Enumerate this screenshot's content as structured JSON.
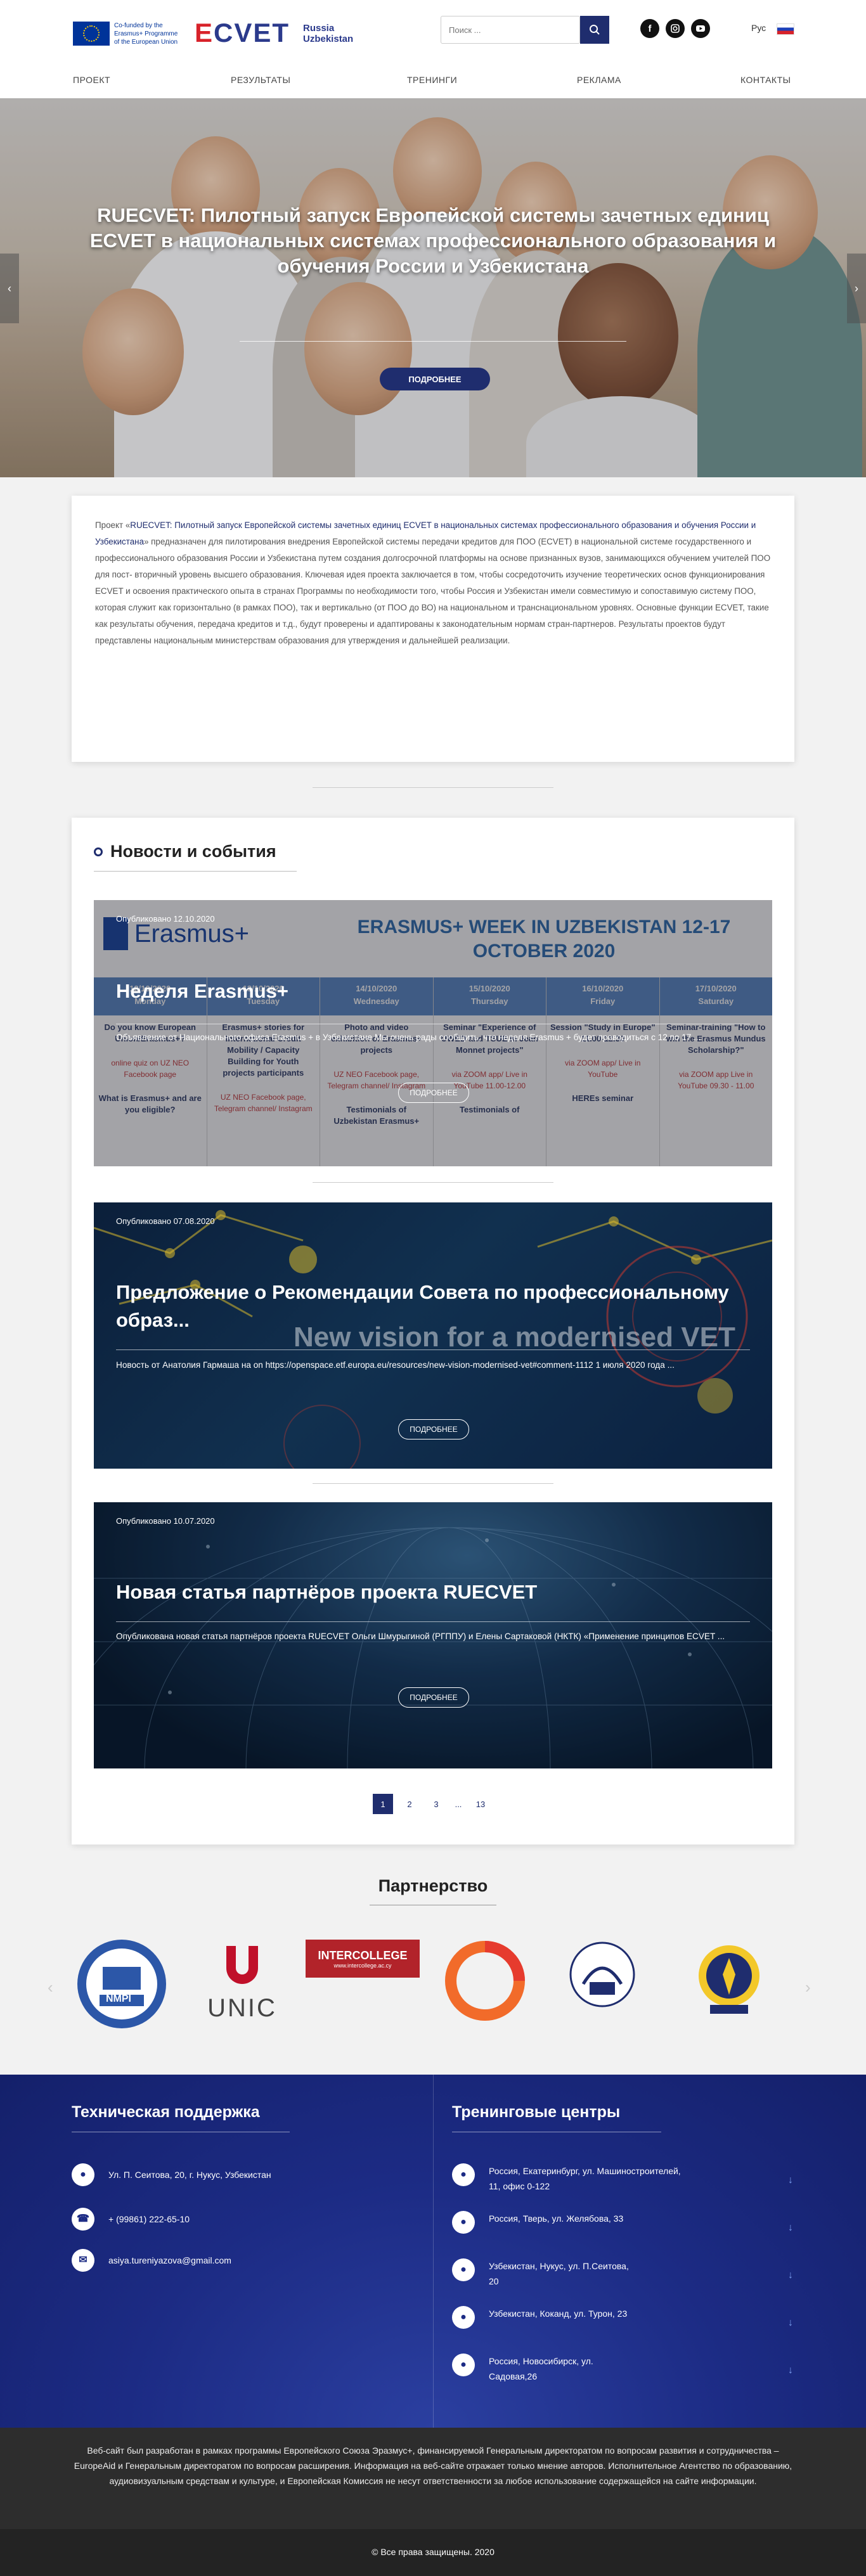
{
  "header": {
    "eu_text": "Co-funded by the Erasmus+ Programme of the European Union",
    "logo_text": "ECVET",
    "logo_sub": "Russia Uzbekistan",
    "search_placeholder": "Поиск ...",
    "lang": "Рус"
  },
  "nav": [
    "ПРОЕКТ",
    "РЕЗУЛЬТАТЫ",
    "ТРЕНИНГИ",
    "РЕКЛАМА",
    "КОНТАКТЫ"
  ],
  "hero": {
    "title": "RUECVET: Пилотный запуск Европейской системы зачетных единиц ECVET в национальных системах профессионального образования и обучения России и Узбекистана",
    "button": "ПОДРОБНЕЕ"
  },
  "about": {
    "prefix": "Проект «",
    "highlight": "RUECVET: Пилотный запуск Европейской системы зачетных единиц ECVET в национальных системах профессионального образования и обучения России и Узбекистана",
    "body": "» предназначен для пилотирования внедрения Европейской системы передачи кредитов для ПОО (ECVET) в национальной системе государственного и профессионального образования России и Узбекистана путем создания долгосрочной платформы на основе признанных вузов, занимающихся обучением учителей ПОО для пост- вторичный уровень высшего образования. Ключевая идея проекта заключается в том, чтобы сосредоточить изучение теоретических основ функционирования ECVET и освоения практического опыта в странах Программы по необходимости того, чтобы Россия и Узбекистан имели совместимую и сопоставимую систему ПОО, которая служит как горизонтально (в рамках ПОО), так и вертикально (от ПОО до ВО) на национальном и транснациональном уровнях. Основные функции ECVET, такие как результаты обучения, передача кредитов и т.д., будут проверены и адаптированы к законодательным нормам стран-партнеров. Результаты проектов будут представлены национальным министерствам образования для утверждения и дальнейшей реализации."
  },
  "news": {
    "title": "Новости и события",
    "button": "ПОДРОБНЕЕ",
    "posts": [
      {
        "date": "Опубликовано 12.10.2020",
        "title": "Неделя Erasmus+",
        "excerpt": "Объявление от Национального офиса Erasmus + в Узбекистане Мы очень рады сообщить, что неделя Erasmus + будет проводиться с 12 по 17 ..."
      },
      {
        "date": "Опубликовано 07.08.2020",
        "title": "Предложение о Рекомендации Совета по профессиональному образ...",
        "excerpt": "Новость от Анатолия Гармаша на on https://openspace.etf.europa.eu/resources/new-vision-modernised-vet#comment-1112 1 июля 2020 года ..."
      },
      {
        "date": "Опубликовано 10.07.2020",
        "title": "Новая статья партнёров проекта RUECVET",
        "excerpt": "Опубликована новая статья партнёров проекта RUECVET Ольги Шмурыгиной (РГППУ) и Елены Сартаковой (НКТК) «Применение принципов ECVET ..."
      }
    ],
    "erasmus_banner": {
      "logo": "Erasmus+",
      "heading": "ERASMUS+ WEEK IN UZBEKISTAN 12-17 OCTOBER 2020",
      "days": [
        {
          "date": "12/10/2020",
          "day": "Monday",
          "text": "Do you know European Union/Erasmus+?",
          "note": "online quiz on UZ NEO Facebook page",
          "extra": "What is Erasmus+ and are you eligible?"
        },
        {
          "date": "13/10/2020",
          "day": "Tuesday",
          "text": "Erasmus+ stories for International Credit Mobility / Capacity Building for Youth projects participants",
          "note": "UZ NEO Facebook page, Telegram channel/ Instagram",
          "extra": ""
        },
        {
          "date": "14/10/2020",
          "day": "Wednesday",
          "text": "Photo and video exhibition of Erasmus+ projects",
          "note": "UZ NEO Facebook page, Telegram channel/ Instagram",
          "extra": "Testimonials of Uzbekistan Erasmus+"
        },
        {
          "date": "15/10/2020",
          "day": "Thursday",
          "text": "Seminar \"Experience of UWED and TSUE in Jean Monnet projects\"",
          "note": "via ZOOM app/ Live in YouTube 11.00-12.00",
          "extra": "Testimonials of"
        },
        {
          "date": "16/10/2020",
          "day": "Friday",
          "text": "Session \"Study in Europe\" 11.00-12.30",
          "note": "via ZOOM app/ Live in YouTube",
          "extra": "HEREs seminar"
        },
        {
          "date": "17/10/2020",
          "day": "Saturday",
          "text": "Seminar-training \"How to win the Erasmus Mundus Scholarship?\"",
          "note": "via ZOOM app Live in YouTube 09.30 - 11.00",
          "extra": ""
        }
      ]
    },
    "vet_banner_text": "New vision for a modernised VET",
    "pages": [
      "1",
      "2",
      "3",
      "...",
      "13"
    ]
  },
  "partners": {
    "title": "Партнерство",
    "logos": [
      "NMPI",
      "UNIC",
      "INTERCOLLEGE",
      "www.intercollege.ac.cy"
    ]
  },
  "footer": {
    "support_title": "Техническая поддержка",
    "support": [
      {
        "icon": "location-icon",
        "text": "Ул. П. Сеитова, 20, г. Нукус, Узбекистан"
      },
      {
        "icon": "phone-icon",
        "text": "+ (99861) 222-65-10"
      },
      {
        "icon": "email-icon",
        "text": "asiya.tureniyazova@gmail.com"
      }
    ],
    "centers_title": "Тренинговые центры",
    "centers": [
      "Россия, Екатеринбург, ул. Машиностроителей, 11, офис 0-122",
      "Россия, Тверь, ул. Желябова, 33",
      "Узбекистан, Нукус, ул. П.Сеитова, 20",
      "Узбекистан, Коканд, ул. Турон, 23",
      "Россия, Новосибирск, ул. Садовая,26"
    ],
    "disclaimer": "Веб-сайт был разработан в рамках программы Европейского Союза Эразмус+, финансируемой Генеральным директоратом по вопросам развития и сотрудничества – EuropeAid и Генеральным директоратом по вопросам расширения. Информация на веб-сайте отражает только мнение авторов. Исполнительное Агентство по образованию, аудиовизуальным средствам и культуре, и Европейская Комиссия не несут ответственности за любое использование содержащейся на сайте информации.",
    "copyright": "© Все права защищены. 2020"
  },
  "colors": {
    "primary": "#1f2d6e",
    "footer": "#1c2b84",
    "accent": "#d8222a"
  }
}
